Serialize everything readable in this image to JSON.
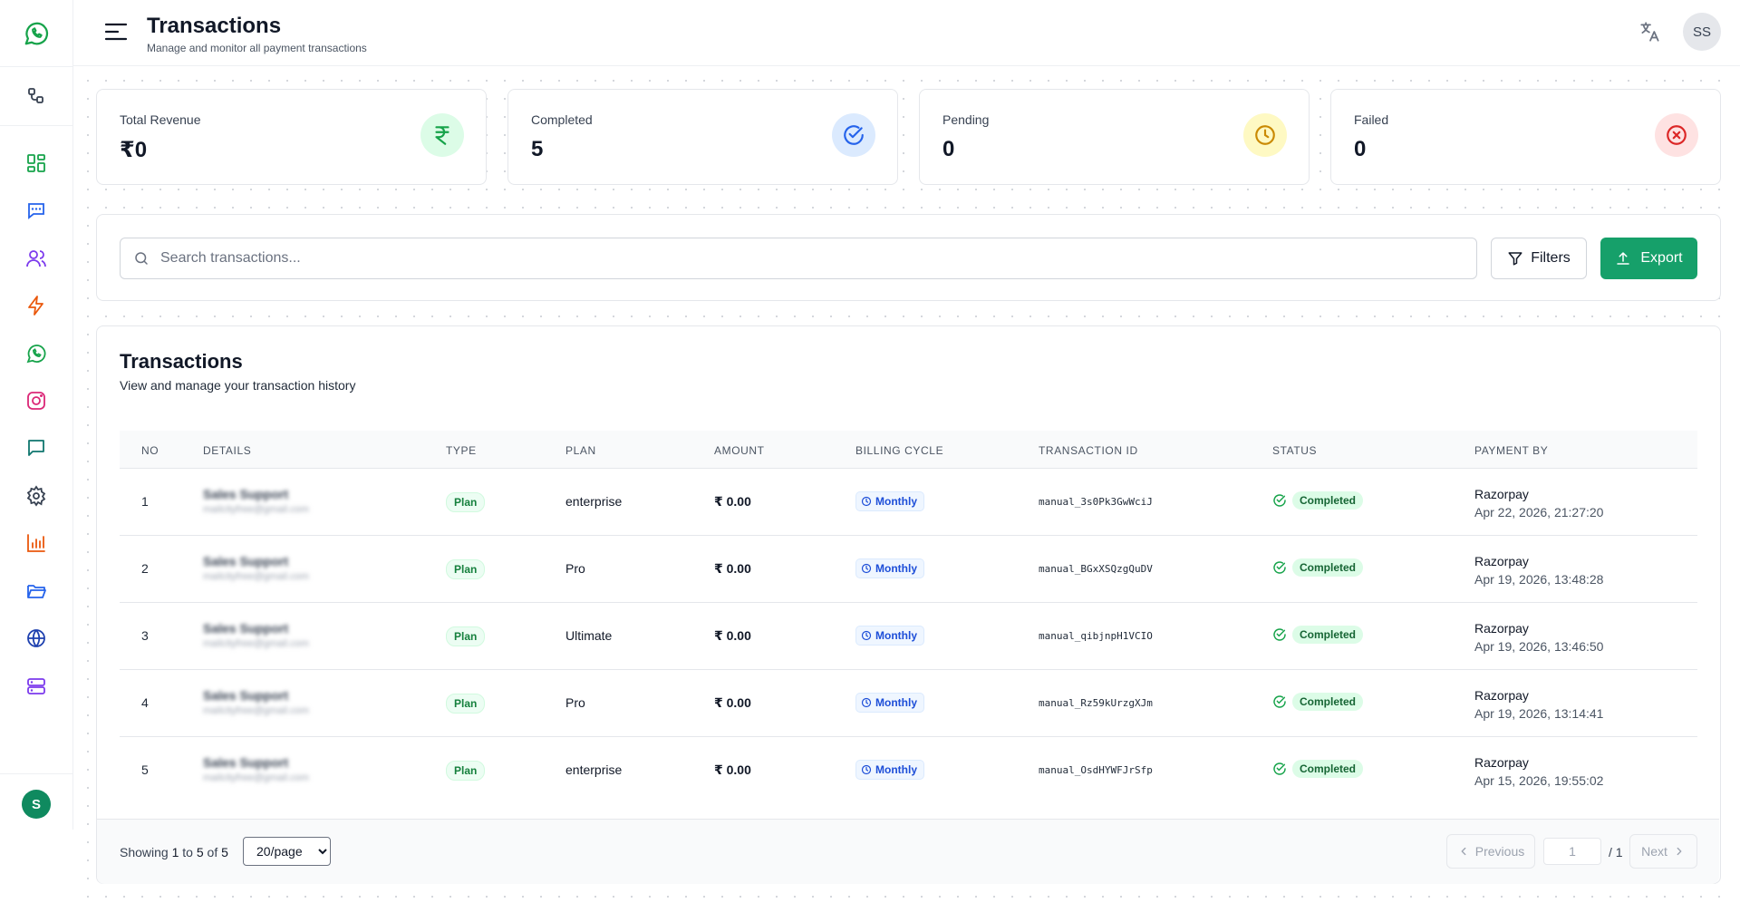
{
  "header": {
    "title": "Transactions",
    "subtitle": "Manage and monitor all payment transactions",
    "user_initials": "SS"
  },
  "sidebar": {
    "avatar_initial": "S",
    "items": [
      {
        "icon": "flow-icon",
        "color": "#374151"
      },
      {
        "icon": "dashboard-icon",
        "color": "#16a34a"
      },
      {
        "icon": "chat-icon",
        "color": "#2563eb"
      },
      {
        "icon": "contacts-icon",
        "color": "#7c3aed"
      },
      {
        "icon": "lightning-icon",
        "color": "#ea580c"
      },
      {
        "icon": "whatsapp-icon",
        "color": "#16a34a"
      },
      {
        "icon": "instagram-icon",
        "color": "#db2777"
      },
      {
        "icon": "message-icon",
        "color": "#0f766e"
      },
      {
        "icon": "gear-icon",
        "color": "#374151"
      },
      {
        "icon": "bar-chart-icon",
        "color": "#ea580c"
      },
      {
        "icon": "folder-icon",
        "color": "#2563eb"
      },
      {
        "icon": "globe-icon",
        "color": "#1e40af"
      },
      {
        "icon": "server-icon",
        "color": "#7c3aed"
      }
    ]
  },
  "stats": [
    {
      "label": "Total Revenue",
      "value": "₹0",
      "icon": "rupee-icon",
      "icon_color": "#16a34a",
      "bg": "#dcfce7"
    },
    {
      "label": "Completed",
      "value": "5",
      "icon": "check-circle-icon",
      "icon_color": "#2563eb",
      "bg": "#dbeafe"
    },
    {
      "label": "Pending",
      "value": "0",
      "icon": "clock-icon",
      "icon_color": "#ca8a04",
      "bg": "#fef9c3"
    },
    {
      "label": "Failed",
      "value": "0",
      "icon": "x-circle-icon",
      "icon_color": "#dc2626",
      "bg": "#fee2e2"
    }
  ],
  "toolbar": {
    "search_placeholder": "Search transactions...",
    "filters_label": "Filters",
    "export_label": "Export"
  },
  "table": {
    "title": "Transactions",
    "subtitle": "View and manage your transaction history",
    "columns": [
      "NO",
      "DETAILS",
      "TYPE",
      "PLAN",
      "AMOUNT",
      "BILLING CYCLE",
      "TRANSACTION ID",
      "STATUS",
      "PAYMENT BY"
    ],
    "rows": [
      {
        "no": "1",
        "name": "Sales Support",
        "email": "mailcityfree@gmail.com",
        "type": "Plan",
        "plan": "enterprise",
        "amount": "₹ 0.00",
        "cycle": "Monthly",
        "txid": "manual_3s0Pk3GwWciJ",
        "status": "Completed",
        "payby": "Razorpay",
        "date": "Apr 22, 2026, 21:27:20"
      },
      {
        "no": "2",
        "name": "Sales Support",
        "email": "mailcityfree@gmail.com",
        "type": "Plan",
        "plan": "Pro",
        "amount": "₹ 0.00",
        "cycle": "Monthly",
        "txid": "manual_BGxXSQzgQuDV",
        "status": "Completed",
        "payby": "Razorpay",
        "date": "Apr 19, 2026, 13:48:28"
      },
      {
        "no": "3",
        "name": "Sales Support",
        "email": "mailcityfree@gmail.com",
        "type": "Plan",
        "plan": "Ultimate",
        "amount": "₹ 0.00",
        "cycle": "Monthly",
        "txid": "manual_qibjnpH1VCIO",
        "status": "Completed",
        "payby": "Razorpay",
        "date": "Apr 19, 2026, 13:46:50"
      },
      {
        "no": "4",
        "name": "Sales Support",
        "email": "mailcityfree@gmail.com",
        "type": "Plan",
        "plan": "Pro",
        "amount": "₹ 0.00",
        "cycle": "Monthly",
        "txid": "manual_Rz59kUrzgXJm",
        "status": "Completed",
        "payby": "Razorpay",
        "date": "Apr 19, 2026, 13:14:41"
      },
      {
        "no": "5",
        "name": "Sales Support",
        "email": "mailcityfree@gmail.com",
        "type": "Plan",
        "plan": "enterprise",
        "amount": "₹ 0.00",
        "cycle": "Monthly",
        "txid": "manual_OsdHYWFJrSfp",
        "status": "Completed",
        "payby": "Razorpay",
        "date": "Apr 15, 2026, 19:55:02"
      }
    ]
  },
  "pagination": {
    "showing_prefix": "Showing",
    "from": "1",
    "to_word": "to",
    "to": "5",
    "of_word": "of",
    "total": "5",
    "per_page": "20/page",
    "prev_label": "Previous",
    "page": "1",
    "total_pages": "/ 1",
    "next_label": "Next"
  }
}
